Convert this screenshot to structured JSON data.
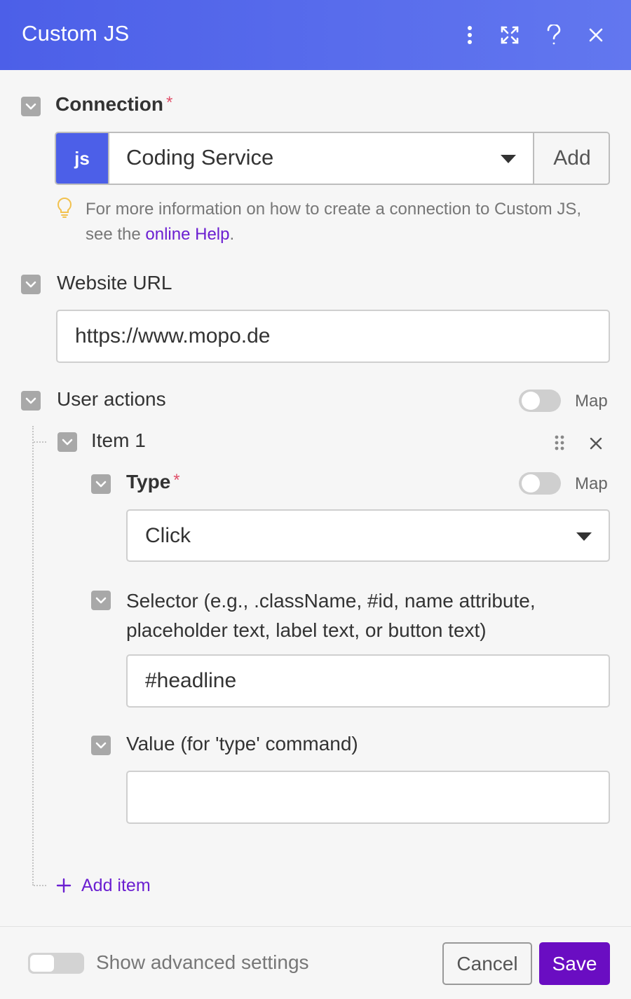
{
  "header": {
    "title": "Custom JS"
  },
  "connection": {
    "label": "Connection",
    "required_mark": "*",
    "badge": "js",
    "selected": "Coding Service",
    "add_label": "Add",
    "help_prefix": "For more information on how to create a connection to Custom JS, see the ",
    "help_link": "online Help",
    "help_suffix": "."
  },
  "website_url": {
    "label": "Website URL",
    "value": "https://www.mopo.de"
  },
  "user_actions": {
    "label": "User actions",
    "map_label": "Map",
    "items": [
      {
        "label": "Item 1",
        "type": {
          "label": "Type",
          "required_mark": "*",
          "map_label": "Map",
          "selected": "Click"
        },
        "selector": {
          "label": "Selector (e.g., .className, #id, name attribute, placeholder text, label text, or button text)",
          "value": "#headline"
        },
        "value_field": {
          "label": "Value (for 'type' command)",
          "value": ""
        }
      }
    ],
    "add_item_label": "Add item"
  },
  "footer": {
    "advanced_label": "Show advanced settings",
    "cancel_label": "Cancel",
    "save_label": "Save"
  },
  "colors": {
    "header_gradient_start": "#4c5fe8",
    "header_gradient_end": "#6277ef",
    "badge": "#4c5fe8",
    "link": "#6b1fd1",
    "save_button": "#6a0dc2",
    "required": "#e0506a"
  },
  "icons": {
    "header": [
      "more-vertical-icon",
      "expand-icon",
      "help-icon",
      "close-icon"
    ],
    "checkbox": "chevron-down-icon",
    "help_hint": "lightbulb-icon",
    "select": "caret-down-icon",
    "item_actions": [
      "drag-handle-icon",
      "close-icon"
    ],
    "add": "plus-icon"
  }
}
